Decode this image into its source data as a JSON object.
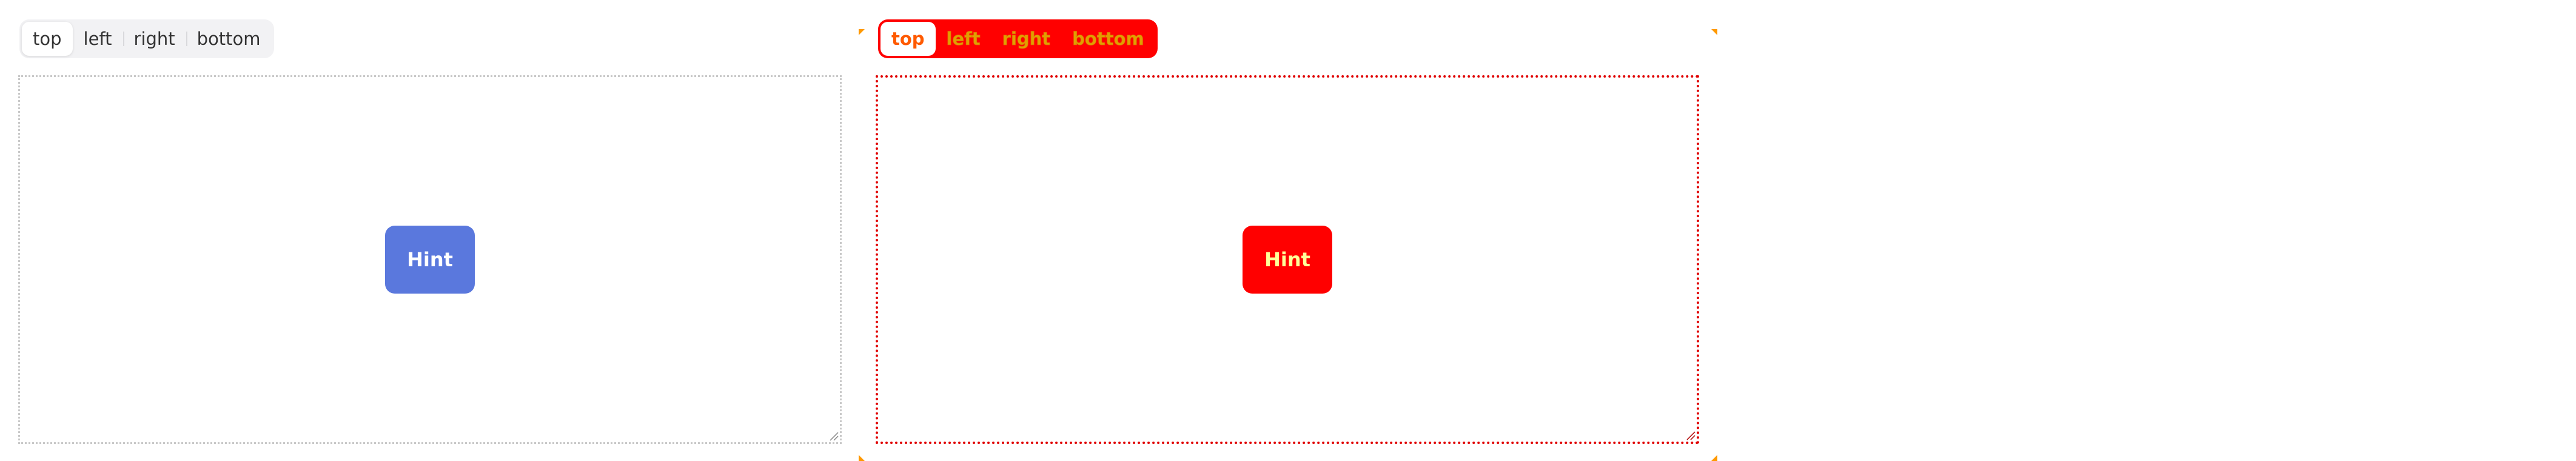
{
  "placement_control": {
    "options": [
      "top",
      "left",
      "right",
      "bottom"
    ],
    "selected": "top"
  },
  "hint_button": {
    "label": "Hint"
  },
  "highlight_view": {
    "options": [
      "top",
      "left",
      "right",
      "bottom"
    ],
    "selected": "top",
    "hint_label": "Hint"
  },
  "colors": {
    "hint_button": "#5a78dd",
    "highlight": "#ff0000",
    "highlight_text": "#e0a000"
  }
}
